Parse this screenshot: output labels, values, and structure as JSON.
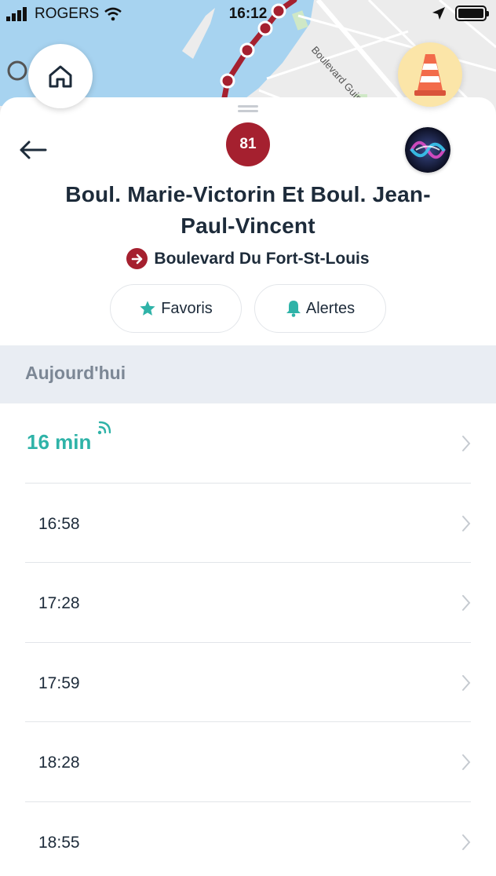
{
  "status_bar": {
    "carrier": "ROGERS",
    "time": "16:12"
  },
  "map": {
    "street_label": "Boulevard Guimond"
  },
  "route": {
    "number": "81",
    "color": "#a5202f"
  },
  "stop": {
    "title": "Boul. Marie-Victorin Et Boul. Jean-Paul-Vincent",
    "direction": "Boulevard Du Fort-St-Louis"
  },
  "actions": {
    "favorites_label": "Favoris",
    "alerts_label": "Alertes"
  },
  "schedule": {
    "section_label": "Aujourd'hui",
    "next_live": "16 min",
    "times": [
      "16:58",
      "17:28",
      "17:59",
      "18:28",
      "18:55"
    ]
  },
  "colors": {
    "accent_teal": "#2fb3a8",
    "text_dark": "#1d2b3a",
    "section_bg": "#e9edf3"
  },
  "icons": {
    "home": "home-icon",
    "cone": "traffic-cone-icon",
    "back": "back-arrow-icon",
    "siri": "siri-icon",
    "direction": "direction-arrow-icon",
    "star": "star-icon",
    "bell": "bell-icon",
    "live": "live-signal-icon",
    "chevron": "chevron-right-icon"
  }
}
